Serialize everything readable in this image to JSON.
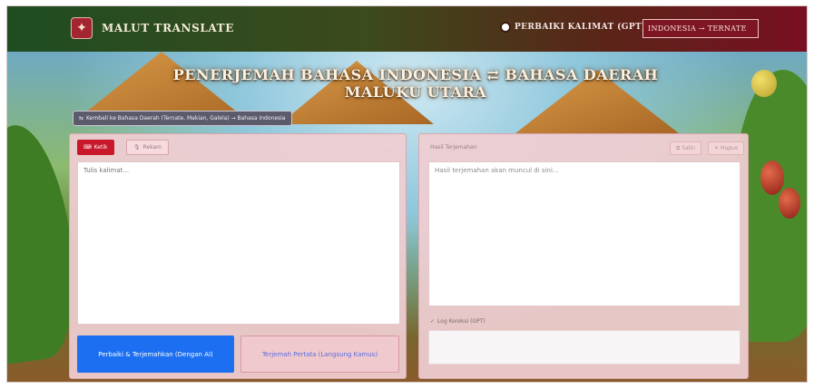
{
  "header": {
    "brand": "MALUT TRANSLATE",
    "toggle_label": "PERBAIKI KALIMAT (GPT)",
    "language_direction": "INDONESIA → TERNATE"
  },
  "banner": {
    "title": "PENERJEMAH BAHASA INDONESIA ⇄ BAHASA DAERAH MALUKU UTARA",
    "reverse_chip": "Kembali ke Bahasa Daerah (Ternate, Makian, Galela) → Bahasa Indonesia"
  },
  "input_panel": {
    "tab_input": "Ketik",
    "tab_other": "Rekam",
    "placeholder": "Tulis kalimat...",
    "primary_button": "Perbaiki & Terjemahkan (Dengan AI)",
    "secondary_button": "Terjemah Pertata (Langsung Kamus)"
  },
  "output_panel": {
    "label": "Hasil Terjemahan",
    "copy_button": "Salin",
    "clear_button": "Hapus",
    "placeholder": "Hasil terjemahan akan muncul di sini...",
    "log_label": "Log Koreksi (GPT)"
  },
  "colors": {
    "header_left": "#1f4d22",
    "header_right": "#7a0f22",
    "primary": "#1c6ff0",
    "tab_active": "#c9182c"
  }
}
